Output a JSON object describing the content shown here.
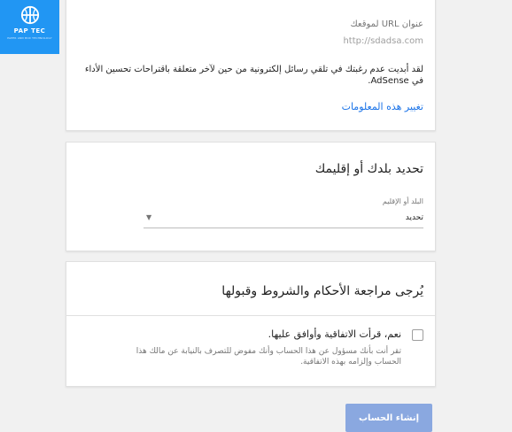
{
  "logo": {
    "brand": "PAP TEC",
    "tagline": "PAPER AND BOX TECHNOLOGY",
    "icon": "globe-icon"
  },
  "site_info": {
    "url_label": "عنوان URL لموقعك",
    "url_value": "http://sdadsa.com",
    "notice": "لقد أبديت عدم رغبتك في تلقي رسائل إلكترونية من حين لآخر متعلقة باقتراحات تحسين الأداء في AdSense.",
    "change_link": "تغيير هذه المعلومات"
  },
  "country_section": {
    "title": "تحديد بلدك أو إقليمك",
    "field_label": "البلد أو الإقليم",
    "selected": "تحديد",
    "arrow_icon": "dropdown-arrow-icon"
  },
  "terms_section": {
    "title": "يُرجى مراجعة الأحكام والشروط وقبولها",
    "checkbox_label": "نعم، قرأت الاتفاقية وأوافق عليها.",
    "checkbox_description": "تقر أنت بأنك مسؤول عن هذا الحساب وأنك مفوض للتصرف بالنيابة عن مالك هذا الحساب وإلزامه بهذه الاتفاقية."
  },
  "actions": {
    "create_account": "إنشاء الحساب"
  },
  "colors": {
    "logo_bg": "#2196f3",
    "link": "#1a73e8",
    "button_bg": "#8aa8e0",
    "page_bg": "#f1f1f1"
  }
}
